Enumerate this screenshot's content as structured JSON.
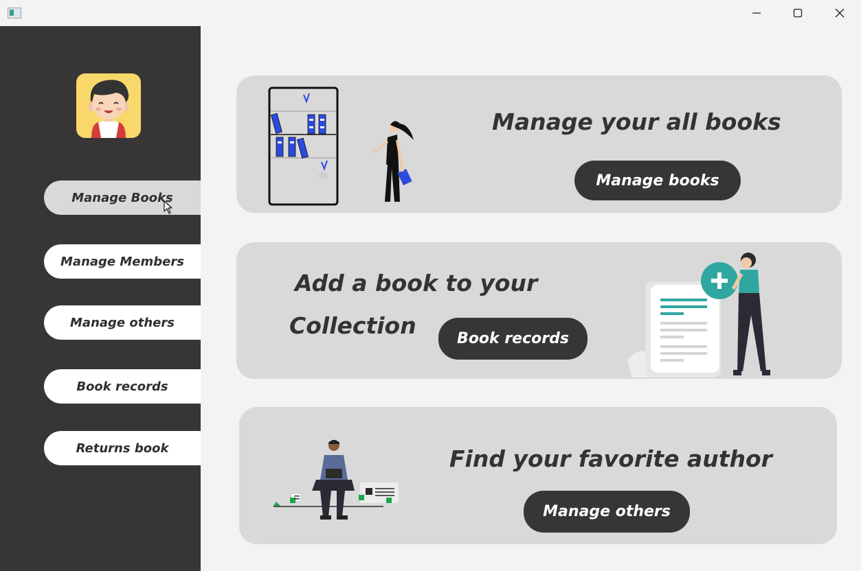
{
  "window": {
    "app_icon": "app-window-icon",
    "controls": [
      "minimize-icon",
      "maximize-icon",
      "close-icon"
    ]
  },
  "sidebar": {
    "avatar": "user-avatar",
    "items": [
      {
        "label": "Manage Books",
        "active": true
      },
      {
        "label": "Manage Members",
        "active": false
      },
      {
        "label": "Manage others",
        "active": false
      },
      {
        "label": "Book records",
        "active": false
      },
      {
        "label": "Returns book",
        "active": false
      }
    ]
  },
  "cards": [
    {
      "title": "Manage your all books",
      "button": "Manage books",
      "illustration": "bookshelf-woman-illustration"
    },
    {
      "title_line1": "Add a book to your",
      "title_line2": "Collection",
      "button": "Book records",
      "illustration": "add-document-woman-illustration"
    },
    {
      "title": "Find your favorite author",
      "button": "Manage others",
      "illustration": "man-with-laptop-illustration"
    }
  ],
  "colors": {
    "sidebar_bg": "#373535",
    "page_bg": "#f3f3f3",
    "card_bg": "#d9d9d9",
    "button_bg": "#373535",
    "accent_teal": "#2fa7a0",
    "accent_blue": "#2b4bdc",
    "accent_green": "#1ca64c"
  }
}
